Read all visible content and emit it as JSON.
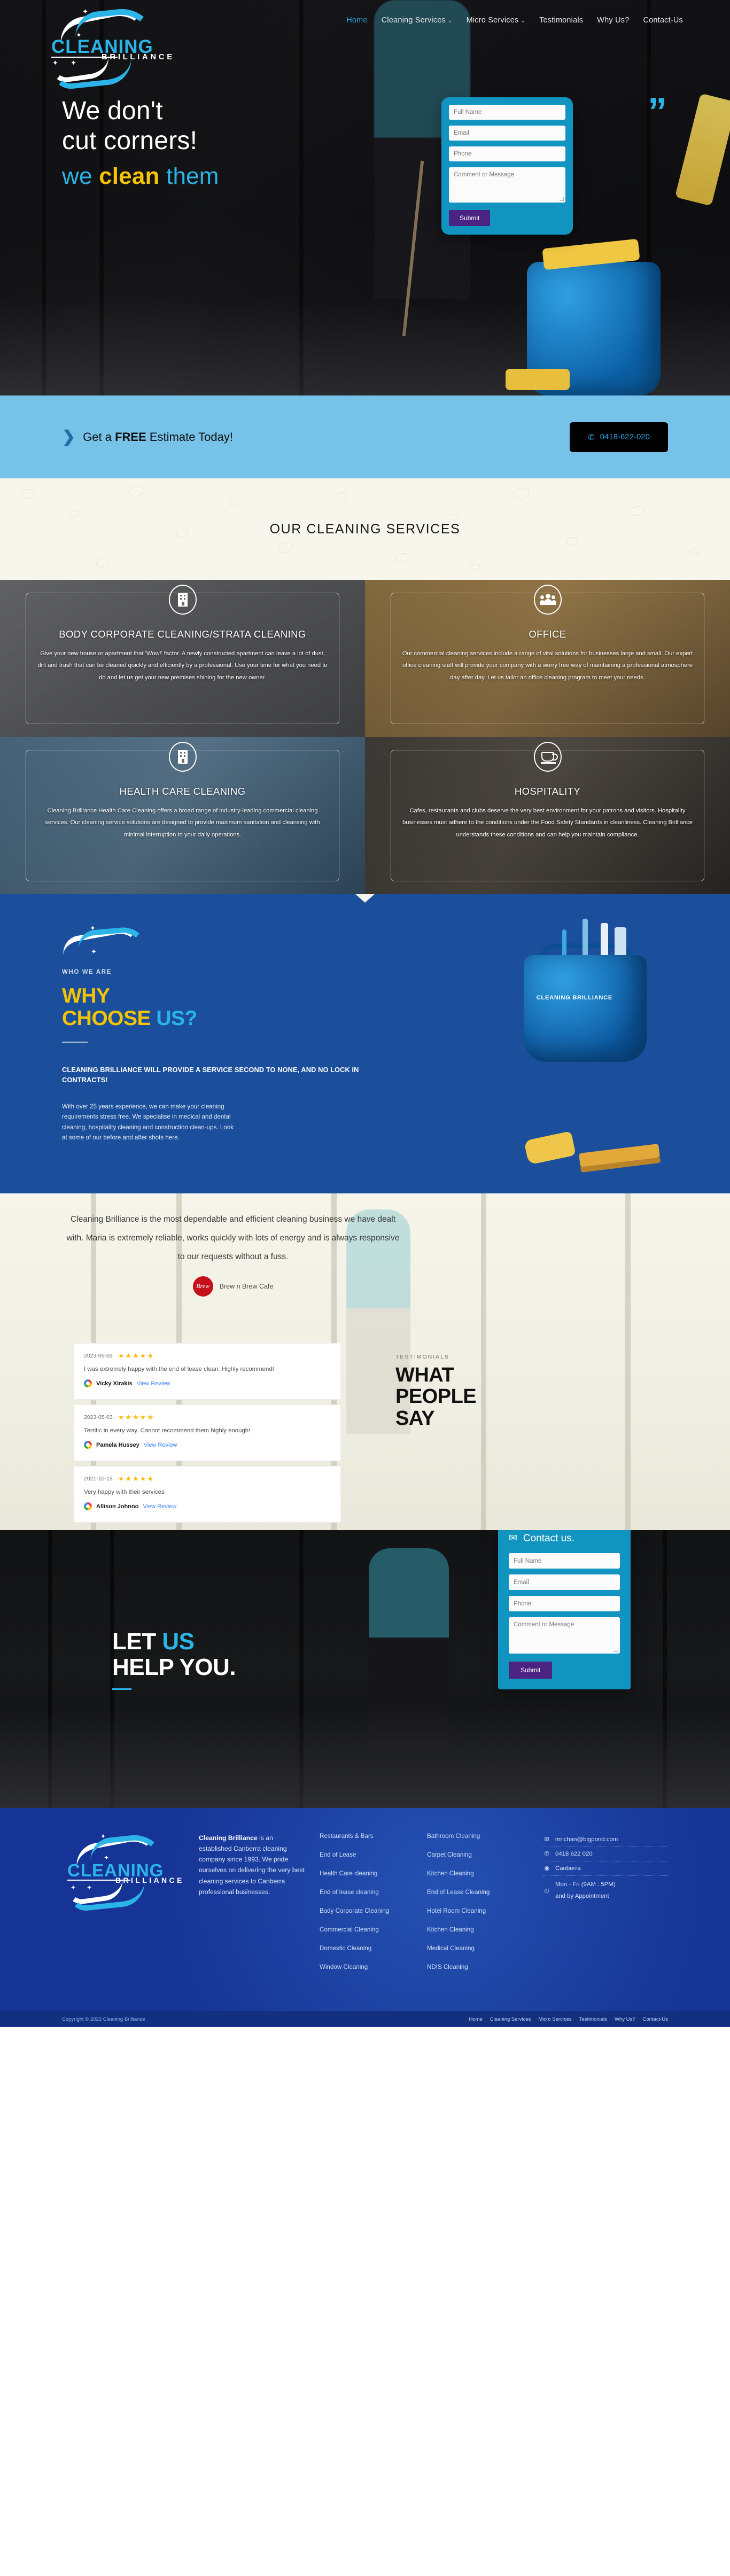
{
  "brand": {
    "name_line1": "CLEANING",
    "name_line2": "BRILLIANCE"
  },
  "nav": {
    "items": [
      {
        "label": "Home",
        "active": true,
        "caret": false
      },
      {
        "label": "Cleaning Services",
        "active": false,
        "caret": true
      },
      {
        "label": "Micro Services",
        "active": false,
        "caret": true
      },
      {
        "label": "Testimonials",
        "active": false,
        "caret": false
      },
      {
        "label": "Why Us?",
        "active": false,
        "caret": false
      },
      {
        "label": "Contact-Us",
        "active": false,
        "caret": false
      }
    ],
    "caret_glyph": "⌄"
  },
  "hero": {
    "headline_line1": "We don't",
    "headline_line2": "cut corners!",
    "sub_pre": "we ",
    "sub_accent": "clean",
    "sub_post": " them",
    "quote_mark": "”",
    "form": {
      "full_name_placeholder": "Full Name",
      "email_placeholder": "Email",
      "phone_placeholder": "Phone",
      "message_placeholder": "Comment or Message",
      "submit_label": "Submit"
    }
  },
  "estimate": {
    "chevron": "❯",
    "text_pre": "Get a ",
    "text_bold": "FREE",
    "text_post": " Estimate Today!",
    "phone_icon": "✆",
    "phone_number": "0418-622-020"
  },
  "services": {
    "title": "OUR CLEANING SERVICES",
    "cards": [
      {
        "icon": "building-icon",
        "title": "BODY CORPORATE CLEANING/STRATA CLEANING",
        "body": "Give your new house or apartment that 'Wow!' factor. A newly constructed apartment can leave a lot of dust, dirt and trash that can be cleaned quickly and efficiently by a professional. Use your time for what you need to do and let us get your new premises shining for the new owner."
      },
      {
        "icon": "people-icon",
        "title": "OFFICE",
        "body": "Our commercial cleaning services include a range of vital solutions for businesses large and small. Our expert office cleaning staff will provide your company with a worry free way of maintaining a professional atmosphere day after day. Let us tailor an office cleaning program to meet your needs."
      },
      {
        "icon": "building-icon",
        "title": "HEALTH CARE CLEANING",
        "body": "Cleaning Brilliance Health Care Cleaning offers a broad range of industry-leading commercial cleaning services. Our cleaning service solutions are designed to provide maximum sanitation and cleansing with minimal interruption to your daily operations."
      },
      {
        "icon": "cup-icon",
        "title": "HOSPITALITY",
        "body": "Cafes, restaurants and clubs deserve the very best environment for your patrons and visitors. Hospitality businesses must adhere to the conditions under the Food Safety Standards in cleanliness. Cleaning Brilliance understands these conditions and can help you maintain compliance."
      }
    ]
  },
  "why": {
    "kicker": "WHO WE ARE",
    "heading_line1": "WHY",
    "heading_line2_a": "CHOOSE ",
    "heading_line2_b": "US?",
    "lead": "CLEANING BRILLIANCE WILL PROVIDE A SERVICE SECOND TO NONE, AND NO LOCK IN CONTRACTS!",
    "body": "With over 25 years experience, we can make your cleaning requirements stress free. We specialise in medical and dental cleaning, hospitality cleaning and construction clean-ups. Look at some of our before and after shots here.",
    "bucket_brand": "CLEANING BRILLIANCE"
  },
  "testimonials": {
    "quote": "Cleaning Brilliance is the most dependable and efficient cleaning business we have dealt with. Maria is extremely reliable, works quickly with lots of energy and is always responsive to our requests without a fuss.",
    "client_logo_text": "Brew",
    "client_name": "Brew n Brew Cafe",
    "section_kicker": "TESTIMONIALS",
    "section_heading_line1": "WHAT",
    "section_heading_line2": "PEOPLE",
    "section_heading_line3": "SAY",
    "stars": "★★★★★",
    "view_review_label": "View Review",
    "reviews": [
      {
        "date": "2023-05-03",
        "text": "I was extremely happy with the end of lease clean. Highly recommend!",
        "author": "Vicky Xirakis"
      },
      {
        "date": "2023-05-03",
        "text": "Terrific in every way. Cannot recommend them highly enough!",
        "author": "Pamela Hussey"
      },
      {
        "date": "2021-10-13",
        "text": "Very happy with their services",
        "author": "Allison Johnno"
      }
    ]
  },
  "contact": {
    "heading_line1_a": "LET ",
    "heading_line1_b": "US",
    "heading_line2": "HELP YOU.",
    "box_title": "Contact us.",
    "box_icon": "✉",
    "full_name_placeholder": "Full Name",
    "email_placeholder": "Email",
    "phone_placeholder": "Phone",
    "message_placeholder": "Comment or Message",
    "submit_label": "Submit"
  },
  "footer": {
    "about_bold": "Cleaning Brilliance",
    "about_rest": " is an established Canberra cleaning company since 1993. We pride ourselves on delivering the very best cleaning services to Canberra professional businesses.",
    "col1": [
      "Restaurants & Bars",
      "End of Lease",
      "Health Care cleaning",
      "End of lease cleaning",
      "Body Corporate Cleaning",
      "Commercial Cleaning",
      "Domestic Cleaning",
      "Window Cleaning"
    ],
    "col2": [
      "Bathroom Cleaning",
      "Carpet Cleaning",
      "Kitchen Cleaning",
      "End of Lease Cleaning",
      "Hotel Room Cleaning",
      "Kitchen Cleaning",
      "Medical Cleaning",
      "NDIS Cleaning"
    ],
    "contact": {
      "email_icon": "✉",
      "email": "mrichan@bigpond.com",
      "phone_icon": "✆",
      "phone": "0418 622 020",
      "location_icon": "◉",
      "location": "Canberra",
      "hours_icon": "◴",
      "hours_line1": "Mon - Fri (9AM : 5PM)",
      "hours_line2": "and by Appointment"
    }
  },
  "copyright": {
    "text": "Copyright © 2023 Cleaning Brilliance",
    "links": [
      "Home",
      "Cleaning Services",
      "Micro Services",
      "Testimonials",
      "Why Us?",
      "Contact-Us"
    ]
  }
}
